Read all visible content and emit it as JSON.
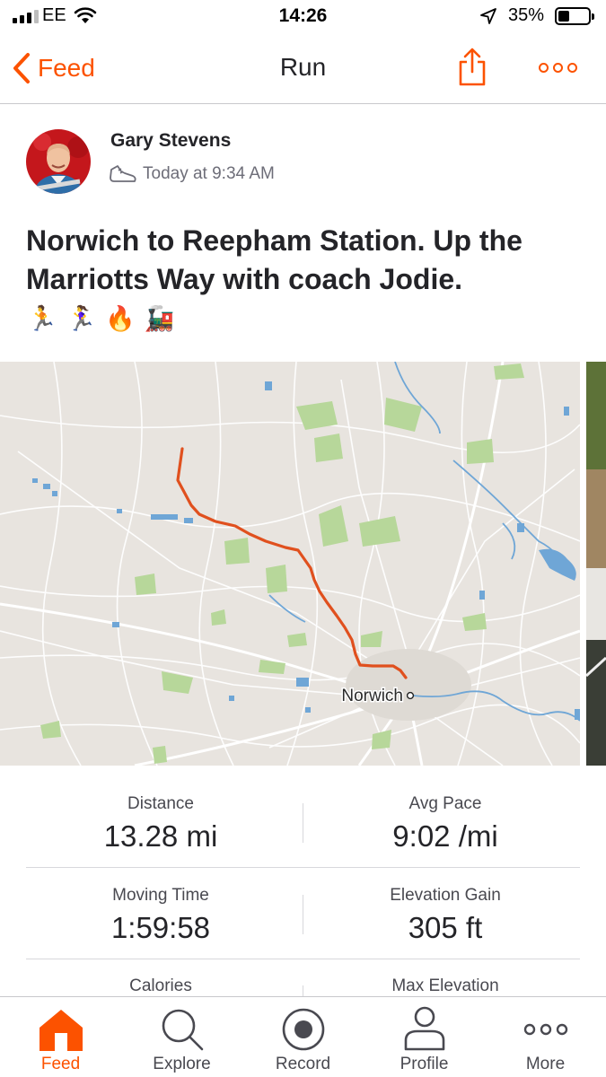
{
  "status_bar": {
    "carrier": "EE",
    "time": "14:26",
    "battery": "35%"
  },
  "nav": {
    "back_label": "Feed",
    "title": "Run"
  },
  "athlete": {
    "name": "Gary Stevens",
    "timestamp": "Today at 9:34 AM"
  },
  "activity": {
    "title": "Norwich to Reepham Station. Up the Marriotts Way with coach Jodie.",
    "emojis": [
      "🏃",
      "🏃‍♀️",
      "🔥",
      "🚂"
    ]
  },
  "map": {
    "city_label": "Norwich",
    "route_color": "#e0501e"
  },
  "stats": [
    {
      "label": "Distance",
      "value": "13.28 mi"
    },
    {
      "label": "Avg Pace",
      "value": "9:02 /mi"
    },
    {
      "label": "Moving Time",
      "value": "1:59:58"
    },
    {
      "label": "Elevation Gain",
      "value": "305 ft"
    },
    {
      "label": "Calories",
      "value": ""
    },
    {
      "label": "Max Elevation",
      "value": ""
    }
  ],
  "tabs": [
    {
      "label": "Feed",
      "icon": "home-icon",
      "active": true
    },
    {
      "label": "Explore",
      "icon": "search-icon",
      "active": false
    },
    {
      "label": "Record",
      "icon": "record-icon",
      "active": false
    },
    {
      "label": "Profile",
      "icon": "profile-icon",
      "active": false
    },
    {
      "label": "More",
      "icon": "more-icon",
      "active": false
    }
  ],
  "colors": {
    "brand": "#fc5200",
    "text": "#242428",
    "muted": "#6d6d78"
  }
}
